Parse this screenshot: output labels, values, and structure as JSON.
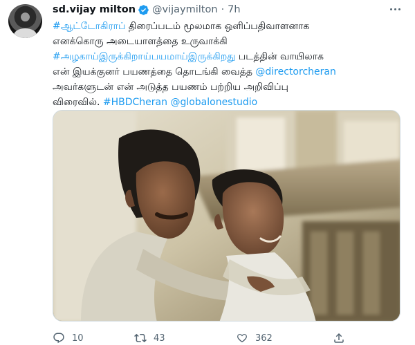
{
  "author": {
    "name": "sd.vijay milton",
    "handle": "@vijaymilton",
    "separator": "·",
    "time": "7h"
  },
  "tweet": {
    "line1_hashtag": "#ஆட்டோகிராப்",
    "line1_text": " திரைப்படம் மூலமாக ஒளிப்பதிவாளனாக",
    "line2_text": "எனக்கொரு அடையாளத்தை உருவாக்கி",
    "line3_hashtag": "#அழகாய்இருக்கிறாய்பயமாய்இருக்கிறது",
    "line3_text": " படத்தின் வாயிலாக",
    "line4_text": "என் இயக்குனர் பயணத்தை தொடங்கி வைத்த ",
    "line4_mention": "@directorcheran",
    "line5_text": "அவர்களுடன் என் அடுத்த பயணம் பற்றிய அறிவிப்பு",
    "line6_text": "விரைவில். ",
    "line6_hashtag": "#HBDCheran",
    "line6_space": " ",
    "line6_mention": "@globalonestudio"
  },
  "actions": {
    "reply_count": "10",
    "retweet_count": "43",
    "like_count": "362"
  },
  "icons": {
    "verified": "verified-badge-icon",
    "reply": "reply-icon",
    "retweet": "retweet-icon",
    "like": "heart-icon",
    "share": "share-icon",
    "more": "more-dots-icon"
  },
  "colors": {
    "link": "#1d9bf0",
    "secondary": "#536471",
    "verified": "#1d9bf0"
  }
}
